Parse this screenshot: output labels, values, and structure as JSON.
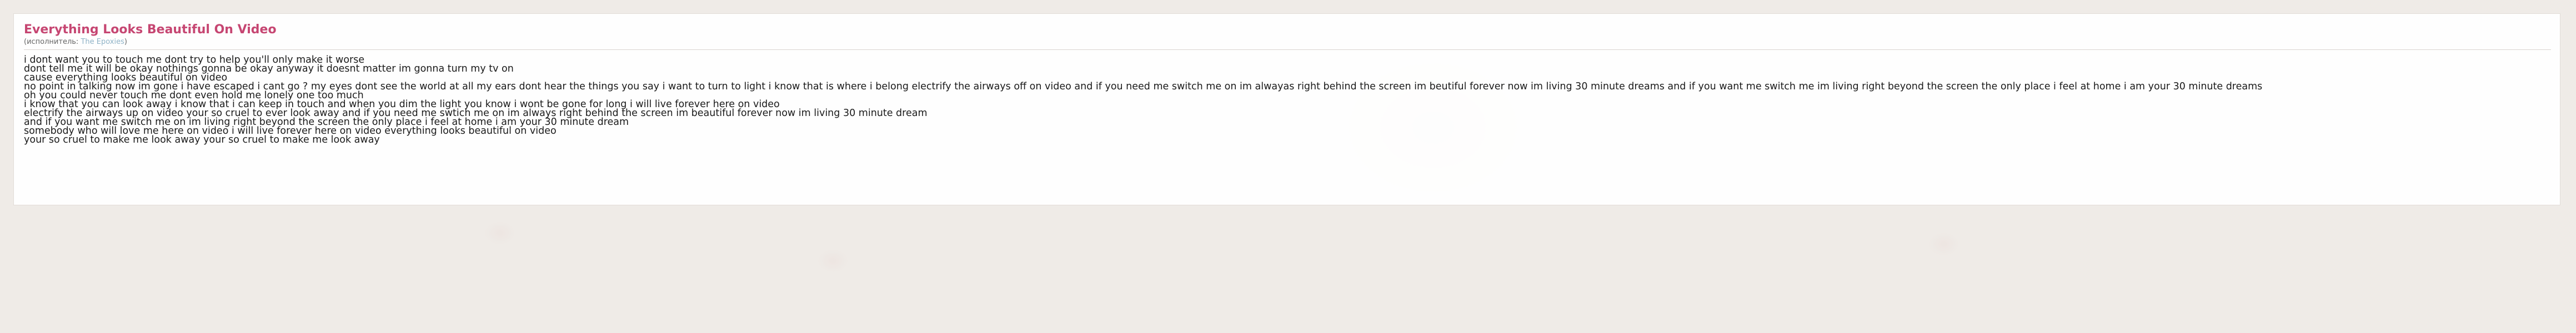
{
  "song": {
    "title": "Everything Looks Beautiful On Video",
    "artist_prefix": "(исполнитель: ",
    "artist": "The Epoxies",
    "artist_suffix": ")"
  },
  "lyrics": [
    "i dont want you to touch me dont try to help you'll only make it worse",
    "dont tell me it will be okay nothings gonna be okay anyway it doesnt matter im gonna turn my tv on",
    "cause everything looks beautiful on video",
    "no point in talking now im gone i have escaped i cant go ? my eyes dont see the world at all my ears dont hear the things you say i want to turn to light i know that is where i belong electrify the airways off on video and if you need me switch me on im alwayas right behind the screen im beutiful forever now im living 30 minute dreams and if you want me switch me im living right beyond the screen the only place i feel at home i am your 30 minute dreams",
    "oh you could never touch me dont even hold me lonely one too much",
    "i know that you can look away i know that i can keep in touch and when you dim the light you know i wont be gone for long i will live forever here on video",
    "electrify the airways up on video your so cruel to ever look away and if you need me swtich me on im always right behind the screen im beautiful forever now im living 30 minute dream",
    "and if you want me switch me on im living right beyond the screen the only place i feel at home i am your 30 minute dream",
    "somebody who will love me here on video i will live forever here on video everything looks beautiful on video",
    "your so cruel to make me look away your so cruel to make me look away"
  ]
}
